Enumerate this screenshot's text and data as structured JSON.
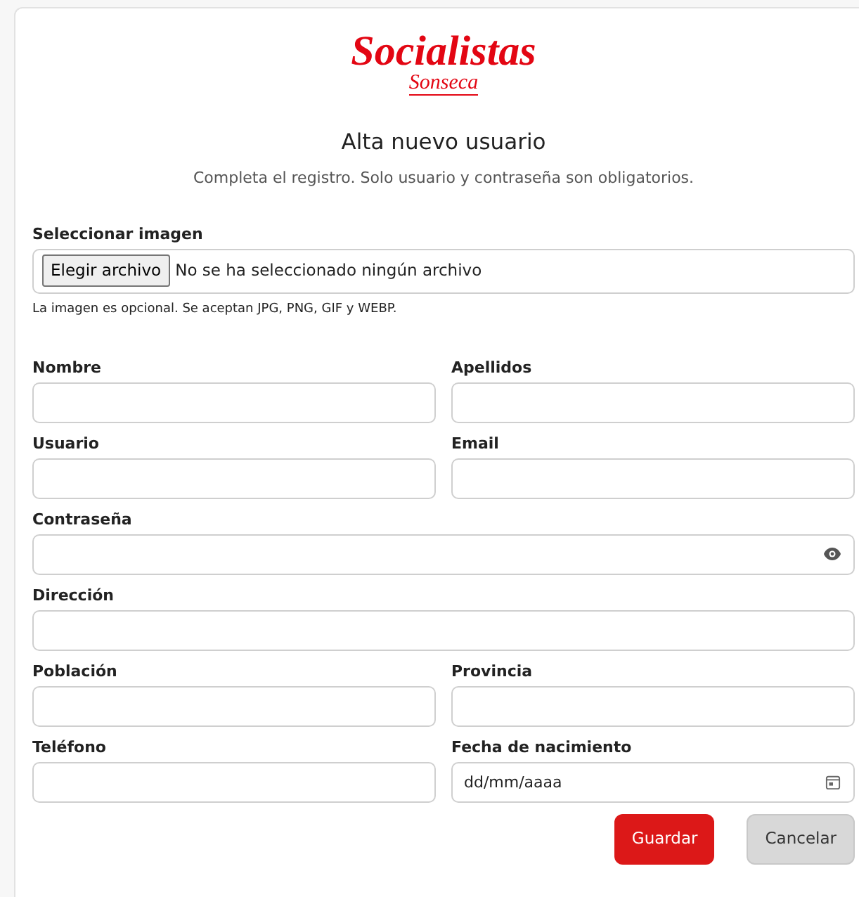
{
  "logo": {
    "line1": "Socialistas",
    "line2": "Sonseca"
  },
  "title": "Alta nuevo usuario",
  "subtitle": "Completa el registro. Solo usuario y contraseña son obligatorios.",
  "image_field": {
    "label": "Seleccionar imagen",
    "button": "Elegir archivo",
    "value": "No se ha seleccionado ningún archivo",
    "hint": "La imagen es opcional. Se aceptan JPG, PNG, GIF y WEBP."
  },
  "rows": [
    [
      {
        "label": "Nombre",
        "kind": "text"
      },
      {
        "label": "Apellidos",
        "kind": "text"
      }
    ],
    [
      {
        "label": "Usuario",
        "kind": "text"
      },
      {
        "label": "Email",
        "kind": "text"
      }
    ],
    [
      {
        "label": "Contraseña",
        "kind": "password"
      }
    ],
    [
      {
        "label": "Dirección",
        "kind": "text"
      }
    ],
    [
      {
        "label": "Población",
        "kind": "text"
      },
      {
        "label": "Provincia",
        "kind": "text"
      }
    ],
    [
      {
        "label": "Teléfono",
        "kind": "text"
      },
      {
        "label": "Fecha de nacimiento",
        "kind": "date",
        "placeholder": "dd/mm/aaaa"
      }
    ]
  ],
  "buttons": [
    {
      "label": "Guardar",
      "kind": "primary"
    },
    {
      "label": "Cancelar",
      "kind": "secondary"
    }
  ]
}
